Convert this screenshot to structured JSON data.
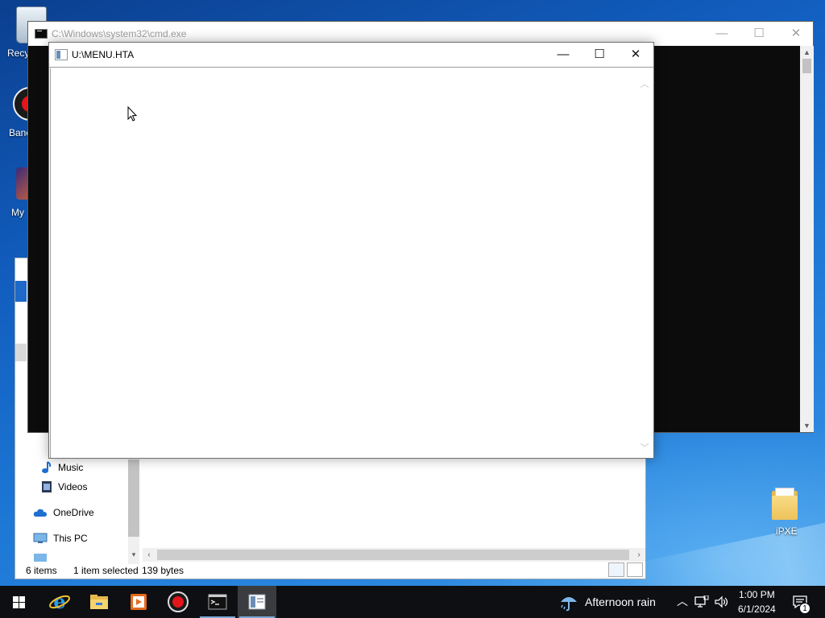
{
  "desktop": {
    "icons": [
      {
        "label": "Recy"
      },
      {
        "label": "Banc"
      },
      {
        "label": "My"
      },
      {
        "label": "iPXE"
      }
    ]
  },
  "explorer": {
    "nav_items": [
      {
        "label": "Music",
        "icon": "music-note-icon"
      },
      {
        "label": "Videos",
        "icon": "videos-icon"
      },
      {
        "label": "OneDrive",
        "icon": "onedrive-cloud-icon"
      },
      {
        "label": "This PC",
        "icon": "this-pc-icon"
      }
    ],
    "status": {
      "items": "6 items",
      "selected": "1 item selected",
      "size": "139 bytes"
    }
  },
  "cmd": {
    "title": "C:\\Windows\\system32\\cmd.exe",
    "controls": {
      "minimize": "—",
      "maximize": "☐",
      "close": "✕"
    }
  },
  "hta": {
    "title": "U:\\MENU.HTA",
    "controls": {
      "minimize": "—",
      "maximize": "☐",
      "close": "✕"
    }
  },
  "taskbar": {
    "apps": [
      "start-icon",
      "internet-explorer-icon",
      "file-explorer-icon",
      "media-player-icon",
      "record-icon",
      "cmd-icon",
      "hta-app-icon"
    ],
    "weather": "Afternoon rain",
    "time": "1:00 PM",
    "date": "6/1/2024",
    "notifications_count": "1"
  },
  "colors": {
    "desktop_blue": "#1565c0",
    "taskbar": "#0d0f13",
    "explorer_selection": "#1e68c7"
  }
}
